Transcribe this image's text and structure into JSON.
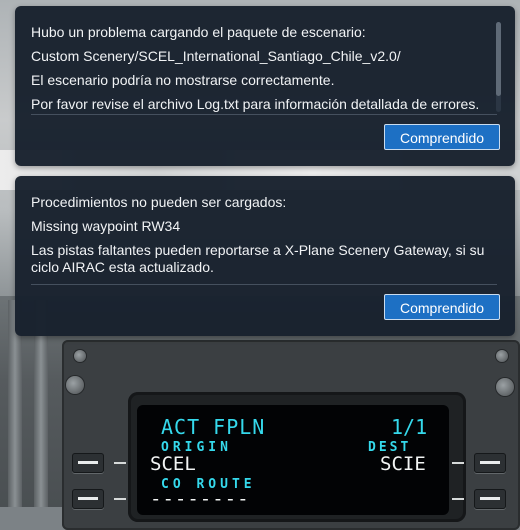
{
  "dialogs": [
    {
      "lines": [
        "Hubo un problema cargando el paquete de escenario:",
        "Custom Scenery/SCEL_International_Santiago_Chile_v2.0/",
        "El escenario podría no mostrarse correctamente.",
        "Por favor revise el archivo Log.txt para información detallada de errores."
      ],
      "button_label": "Comprendido"
    },
    {
      "lines": [
        "Procedimientos no pueden ser cargados:",
        "Missing waypoint RW34",
        "Las pistas faltantes pueden reportarse a X-Plane Scenery Gateway, si su ciclo AIRAC esta actualizado."
      ],
      "button_label": "Comprendido"
    }
  ],
  "fmc": {
    "page_title": "ACT FPLN",
    "page_number": "1/1",
    "origin_label": "ORIGIN",
    "dest_label": "DEST",
    "origin_value": "SCEL",
    "dest_value": "SCIE",
    "co_route_label": "CO ROUTE",
    "co_route_value": "--------"
  },
  "colors": {
    "dialog_bg": "#18212d",
    "button_bg": "#1d70c4",
    "fmc_cyan": "#35d9ec",
    "fmc_white": "#f2f4f4"
  }
}
